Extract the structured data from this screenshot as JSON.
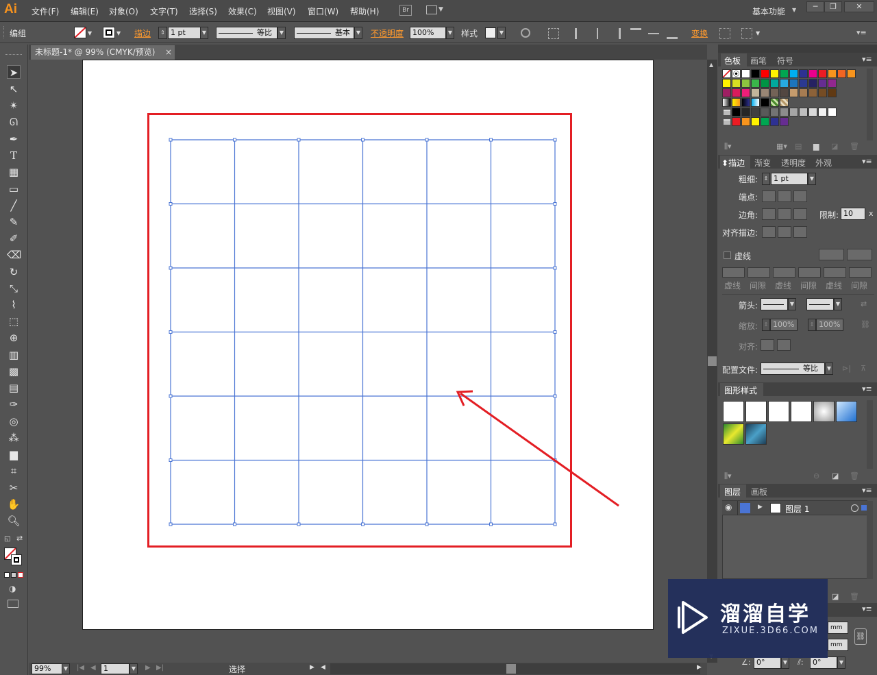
{
  "app": {
    "logo": "Ai"
  },
  "menu": {
    "items": [
      "文件(F)",
      "编辑(E)",
      "对象(O)",
      "文字(T)",
      "选择(S)",
      "效果(C)",
      "视图(V)",
      "窗口(W)",
      "帮助(H)"
    ],
    "bridge": "Br",
    "workspace": "基本功能"
  },
  "window_buttons": {
    "minimize": "─",
    "restore": "❐",
    "close": "✕"
  },
  "control": {
    "group_label": "编组",
    "stroke_label": "描边",
    "stroke_weight": "1 pt",
    "profile_label": "等比",
    "brush_label": "基本",
    "opacity_label": "不透明度",
    "opacity_value": "100%",
    "style_label": "样式",
    "transform_label": "变换"
  },
  "document": {
    "tab_title": "未标题-1* @ 99% (CMYK/预览)",
    "close": "×"
  },
  "grid": {
    "rows": 6,
    "cols": 6
  },
  "swatches_panel": {
    "tabs": [
      "色板",
      "画笔",
      "符号"
    ],
    "colors_row1": [
      "#ffffff",
      "#000000",
      "#ff0000",
      "#fff200",
      "#00a651",
      "#00aeef",
      "#2e3192",
      "#ec008c",
      "#ed1c24",
      "#f7941d",
      "#f26522",
      "#f7941d"
    ],
    "colors_row2": [
      "#fff200",
      "#d7df23",
      "#8dc63f",
      "#39b54a",
      "#009444",
      "#00a99d",
      "#27aae1",
      "#1c75bc",
      "#2b3990",
      "#262262",
      "#662d91",
      "#92278f"
    ],
    "colors_row3": [
      "#9e1f63",
      "#d91c5c",
      "#ed1e79",
      "#c2b59b",
      "#998675",
      "#736357",
      "#534741",
      "#c69c6d",
      "#a67c52",
      "#8c6239",
      "#754c24",
      "#603913"
    ],
    "colors_row5": [
      "#000000",
      "#262626",
      "#404040",
      "#595959",
      "#737373",
      "#8c8c8c",
      "#a6a6a6",
      "#bfbfbf",
      "#d9d9d9",
      "#f2f2f2",
      "#ffffff"
    ],
    "colors_row6": [
      "#ed1c24",
      "#f7941d",
      "#fff200",
      "#00a651",
      "#2e3192",
      "#662d91"
    ]
  },
  "stroke_panel": {
    "tabs": [
      "描边",
      "渐变",
      "透明度",
      "外观"
    ],
    "weight_label": "粗细:",
    "weight_value": "1 pt",
    "cap_label": "端点:",
    "corner_label": "边角:",
    "limit_label": "限制:",
    "limit_value": "10",
    "limit_unit": "x",
    "align_label": "对齐描边:",
    "dashed_label": "虚线",
    "dash_labels": [
      "虚线",
      "间隙",
      "虚线",
      "间隙",
      "虚线",
      "间隙"
    ],
    "arrow_label": "箭头:",
    "scale_label": "缩放:",
    "scale_start": "100%",
    "scale_end": "100%",
    "align2_label": "对齐:",
    "profile_label": "配置文件:",
    "profile_value": "等比"
  },
  "graphic_styles": {
    "title": "图形样式"
  },
  "layers_panel": {
    "tabs": [
      "图层",
      "画板"
    ],
    "layer_name": "图层 1"
  },
  "bottom_panel": {
    "unit1": "mm",
    "unit2": "mm",
    "angle1": "0°",
    "angle2": "0°"
  },
  "status": {
    "zoom": "99%",
    "artboard_nav": "1",
    "tool_name": "选择"
  },
  "watermark": {
    "brand": "溜溜自学",
    "url": "ZIXUE.3D66.COM"
  },
  "colors": {
    "annotation_red": "#e31e24",
    "grid_blue": "#4a74d4",
    "panel_bg": "#535353"
  }
}
